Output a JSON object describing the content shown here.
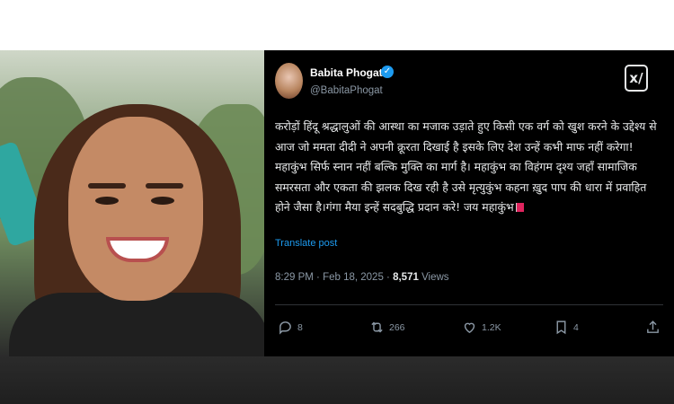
{
  "tweet": {
    "author_name": "Babita Phogat",
    "handle": "@BabitaPhogat",
    "text": "करोड़ों हिंदू श्रद्धालुओं की आस्था का मजाक उड़ाते हुए किसी एक वर्ग को खुश करने के उद्देश्य से आज जो ममता दीदी ने अपनी क्रूरता दिखाई है इसके लिए देश उन्हें कभी माफ नहीं करेगा! महाकुंभ सिर्फ स्नान नहीं बल्कि मुक्ति का मार्ग है। महाकुंभ का विहंगम दृश्य जहाँ सामाजिक समरसता और एकता की झलक दिख रही है उसे मृत्युकुंभ कहना ख़ुद पाप की धारा में प्रवाहित होने जैसा है।गंगा मैया इन्हें सदबुद्धि प्रदान करे! जय महाकुंभ",
    "translate_label": "Translate post",
    "time": "8:29 PM",
    "date": "Feb 18, 2025",
    "views_count": "8,571",
    "views_label": "Views",
    "replies": "8",
    "reposts": "266",
    "likes": "1.2K",
    "bookmarks": "4"
  },
  "icons": {
    "verified": "verified-badge-icon",
    "grok": "grok-icon",
    "reply": "reply-icon",
    "repost": "repost-icon",
    "like": "heart-icon",
    "bookmark": "bookmark-icon",
    "share": "share-icon"
  },
  "colors": {
    "accent": "#1d9bf0",
    "background": "#000000",
    "muted": "#8b98a5"
  }
}
